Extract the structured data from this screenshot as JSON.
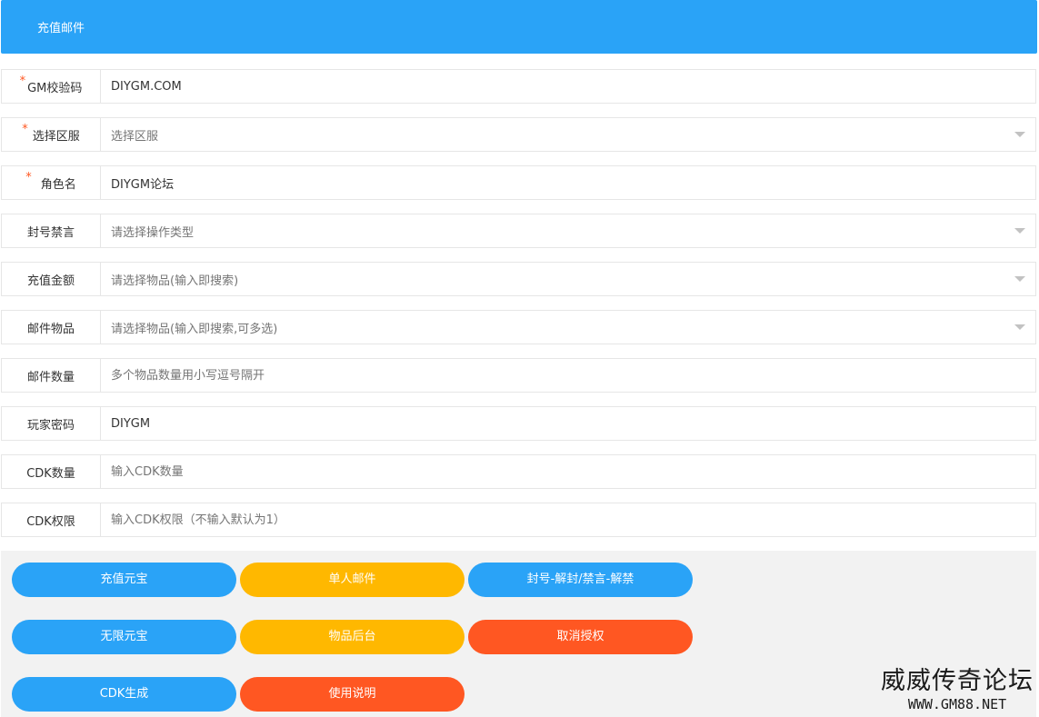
{
  "header": {
    "title": "充值邮件"
  },
  "form": {
    "gm_code": {
      "label": "GM校验码",
      "required_mark": "*",
      "value": "DIYGM.COM"
    },
    "server": {
      "label": "选择区服",
      "required_mark": "*",
      "placeholder": "选择区服"
    },
    "role_name": {
      "label": "角色名",
      "required_mark": "*",
      "value": "DIYGM论坛"
    },
    "ban_mute": {
      "label": "封号禁言",
      "placeholder": "请选择操作类型"
    },
    "recharge_amount": {
      "label": "充值金额",
      "placeholder": "请选择物品(输入即搜索)"
    },
    "mail_items": {
      "label": "邮件物品",
      "placeholder": "请选择物品(输入即搜索,可多选)"
    },
    "mail_quantity": {
      "label": "邮件数量",
      "placeholder": "多个物品数量用小写逗号隔开"
    },
    "player_password": {
      "label": "玩家密码",
      "value": "DIYGM"
    },
    "cdk_count": {
      "label": "CDK数量",
      "placeholder": "输入CDK数量"
    },
    "cdk_permission": {
      "label": "CDK权限",
      "placeholder": "输入CDK权限（不输入默认为1）"
    }
  },
  "buttons": {
    "recharge_yuanbao": "充值元宝",
    "single_mail": "单人邮件",
    "ban_unban": "封号-解封/禁言-解禁",
    "unlimited_yuanbao": "无限元宝",
    "item_backend": "物品后台",
    "cancel_auth": "取消授权",
    "cdk_generate": "CDK生成",
    "instructions": "使用说明"
  },
  "watermark": {
    "main": "威威传奇论坛",
    "sub": "WWW.GM88.NET"
  },
  "colors": {
    "blue": "#2aa3f7",
    "yellow": "#ffb800",
    "red": "#ff5722",
    "panel": "#f2f2f2"
  }
}
